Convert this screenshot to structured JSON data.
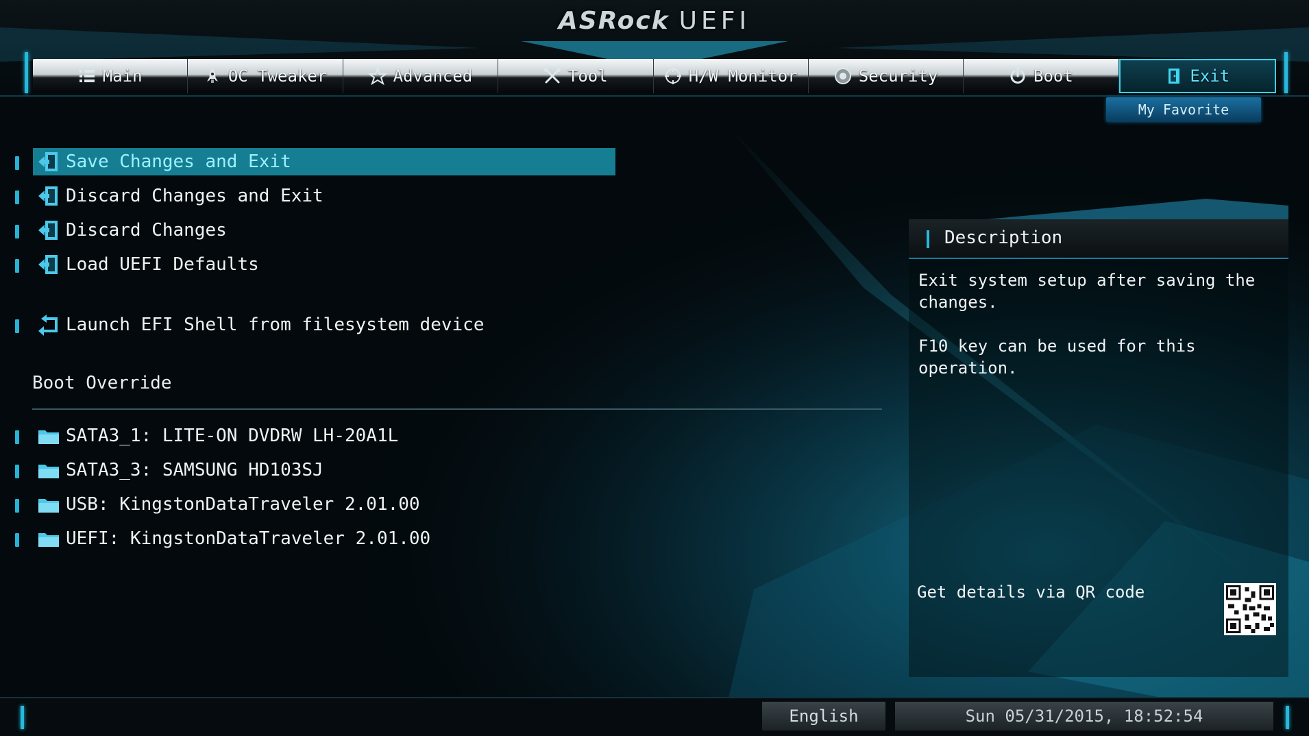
{
  "header": {
    "brand": "ASRock",
    "product": "UEFI"
  },
  "tabs": [
    {
      "label": "Main",
      "icon": "list-icon"
    },
    {
      "label": "OC Tweaker",
      "icon": "rocket-icon"
    },
    {
      "label": "Advanced",
      "icon": "star-icon"
    },
    {
      "label": "Tool",
      "icon": "tools-icon"
    },
    {
      "label": "H/W Monitor",
      "icon": "crosshair-icon"
    },
    {
      "label": "Security",
      "icon": "shield-icon"
    },
    {
      "label": "Boot",
      "icon": "power-icon"
    },
    {
      "label": "Exit",
      "icon": "exit-door-icon",
      "active": true
    }
  ],
  "favorite": {
    "label": "My Favorite"
  },
  "menu": {
    "items": [
      {
        "label": "Save Changes and Exit",
        "icon": "exit-arrow-icon",
        "selected": true
      },
      {
        "label": "Discard Changes and Exit",
        "icon": "exit-arrow-icon"
      },
      {
        "label": "Discard Changes",
        "icon": "exit-arrow-icon"
      },
      {
        "label": "Load UEFI Defaults",
        "icon": "exit-arrow-icon"
      },
      {
        "label": "Launch EFI Shell from filesystem device",
        "icon": "return-arrow-icon"
      }
    ],
    "boot_override_label": "Boot Override",
    "boot_devices": [
      {
        "label": "SATA3_1: LITE-ON DVDRW LH-20A1L",
        "icon": "folder-icon"
      },
      {
        "label": "SATA3_3: SAMSUNG HD103SJ",
        "icon": "folder-icon"
      },
      {
        "label": "USB: KingstonDataTraveler 2.01.00",
        "icon": "folder-icon"
      },
      {
        "label": "UEFI: KingstonDataTraveler 2.01.00",
        "icon": "folder-icon"
      }
    ]
  },
  "description": {
    "title": "Description",
    "text": "Exit system setup after saving the\nchanges.\n\nF10 key can be used for this operation.",
    "qr_label": "Get details via QR code",
    "qr_icon": "qr-code-icon"
  },
  "footer": {
    "language": "English",
    "datetime": "Sun 05/31/2015, 18:52:54"
  },
  "colors": {
    "accent": "#27b8dc",
    "selected_bg": "#167e92",
    "selected_text": "#9df1ff",
    "background": "#03090c"
  }
}
